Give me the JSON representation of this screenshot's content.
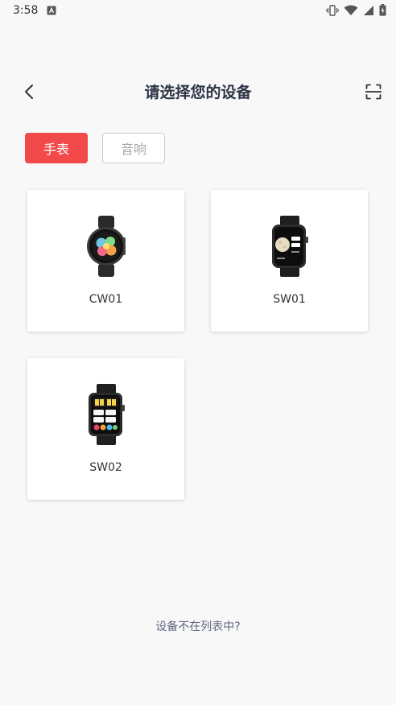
{
  "status_bar": {
    "time": "3:58",
    "icons": [
      "app-notification-icon",
      "vibrate-icon",
      "wifi-icon",
      "cellular-signal-icon",
      "battery-charging-icon"
    ]
  },
  "header": {
    "title": "请选择您的设备",
    "back_icon": "chevron-left-icon",
    "scan_icon": "scan-icon"
  },
  "tabs": [
    {
      "label": "手表",
      "selected": true
    },
    {
      "label": "音响",
      "selected": false
    }
  ],
  "devices": [
    {
      "name": "CW01",
      "image": "round-smartwatch-icon"
    },
    {
      "name": "SW01",
      "image": "square-smartwatch-icon"
    },
    {
      "name": "SW02",
      "image": "square-smartwatch-icon"
    }
  ],
  "footer": {
    "link_text": "设备不在列表中?"
  },
  "colors": {
    "accent": "#f24a4a",
    "title": "#2c3445",
    "link": "#5f6880",
    "background": "#f8f8f8"
  }
}
